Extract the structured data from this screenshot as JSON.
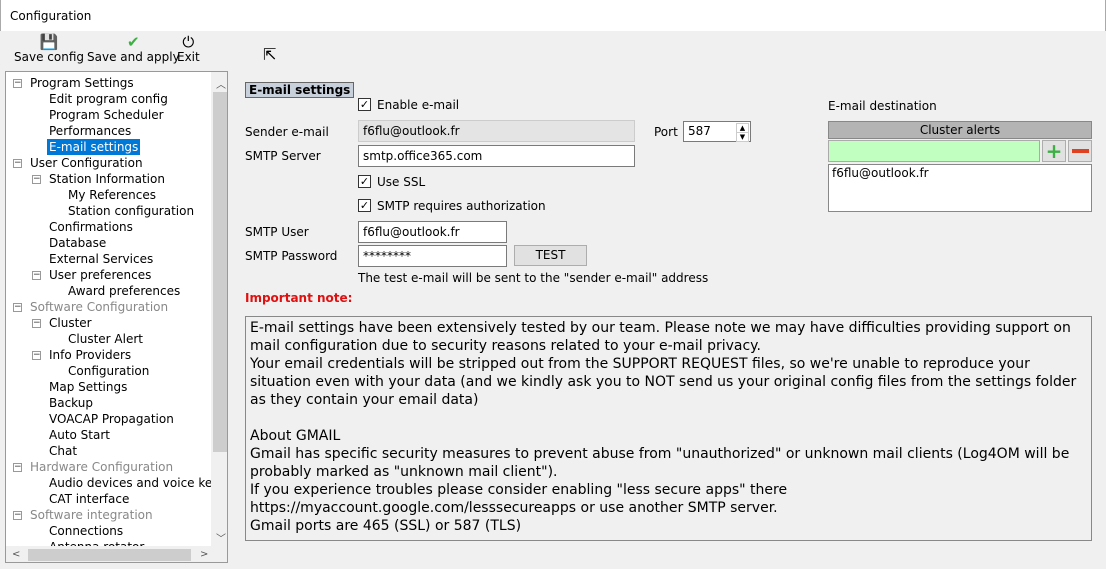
{
  "window": {
    "title": "Configuration"
  },
  "toolbar": [
    {
      "label": "Save config",
      "icon": "floppy-icon"
    },
    {
      "label": "Save and apply",
      "icon": "checkmark-icon"
    },
    {
      "label": "Exit",
      "icon": "power-icon"
    }
  ],
  "tree": [
    {
      "label": "Program Settings",
      "level": 0,
      "grey": false
    },
    {
      "label": "Edit program config",
      "level": 1
    },
    {
      "label": "Program Scheduler",
      "level": 1
    },
    {
      "label": "Performances",
      "level": 1
    },
    {
      "label": "E-mail settings",
      "level": 1,
      "selected": true
    },
    {
      "label": "User Configuration",
      "level": 0
    },
    {
      "label": "Station Information",
      "level": 1,
      "expander": true
    },
    {
      "label": "My References",
      "level": 2
    },
    {
      "label": "Station configuration",
      "level": 2
    },
    {
      "label": "Confirmations",
      "level": 1
    },
    {
      "label": "Database",
      "level": 1
    },
    {
      "label": "External Services",
      "level": 1
    },
    {
      "label": "User preferences",
      "level": 1,
      "expander": true
    },
    {
      "label": "Award preferences",
      "level": 2
    },
    {
      "label": "Software Configuration",
      "level": 0,
      "grey": true
    },
    {
      "label": "Cluster",
      "level": 1,
      "expander": true
    },
    {
      "label": "Cluster Alert",
      "level": 2
    },
    {
      "label": "Info Providers",
      "level": 1,
      "expander": true
    },
    {
      "label": "Configuration",
      "level": 2
    },
    {
      "label": "Map Settings",
      "level": 1
    },
    {
      "label": "Backup",
      "level": 1
    },
    {
      "label": "VOACAP Propagation",
      "level": 1
    },
    {
      "label": "Auto Start",
      "level": 1
    },
    {
      "label": "Chat",
      "level": 1
    },
    {
      "label": "Hardware Configuration",
      "level": 0,
      "grey": true
    },
    {
      "label": "Audio devices and voice keyer",
      "level": 1
    },
    {
      "label": "CAT interface",
      "level": 1
    },
    {
      "label": "Software integration",
      "level": 0,
      "grey": true
    },
    {
      "label": "Connections",
      "level": 1
    },
    {
      "label": "Antenna rotator",
      "level": 1
    }
  ],
  "email": {
    "section_title": "E-mail settings",
    "enable_label": "Enable e-mail",
    "enable_checked": true,
    "sender_label": "Sender e-mail",
    "sender_value": "f6flu@outlook.fr",
    "port_label": "Port",
    "port_value": "587",
    "smtp_server_label": "SMTP Server",
    "smtp_server_value": "smtp.office365.com",
    "ssl_label": "Use SSL",
    "ssl_checked": true,
    "auth_label": "SMTP requires authorization",
    "auth_checked": true,
    "user_label": "SMTP User",
    "user_value": "f6flu@outlook.fr",
    "password_label": "SMTP Password",
    "password_value": "********",
    "test_button": "TEST",
    "test_hint": "The test e-mail will be sent to the \"sender e-mail\" address",
    "important_label": "Important note:",
    "important_color": "#e01010"
  },
  "destination": {
    "label": "E-mail destination",
    "header": "Cluster alerts",
    "input_value": "",
    "input_color": "#c0ffc0",
    "items": [
      "f6flu@outlook.fr"
    ]
  },
  "note": [
    "E-mail settings have been extensively tested by our team. Please note we may have difficulties providing support on mail configuration due to security reasons related to your e-mail privacy.",
    "Your email credentials will be stripped out from the SUPPORT REQUEST files, so we're unable to reproduce your situation even with your data (and we kindly ask you to NOT send us your original config files from the settings folder as they contain your email data)",
    "",
    "About GMAIL",
    "Gmail has specific security measures to prevent abuse from \"unauthorized\" or unknown mail clients (Log4OM will be probably marked as \"unknown mail client\").",
    "If you experience troubles please consider enabling \"less secure apps\" there https://myaccount.google.com/lesssecureapps or use another SMTP server.",
    "Gmail ports are 465 (SSL) or 587 (TLS)"
  ]
}
